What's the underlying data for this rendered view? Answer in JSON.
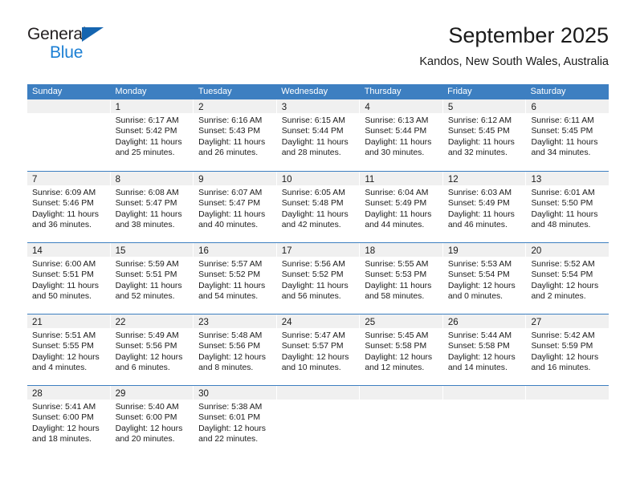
{
  "brand": {
    "line1": "General",
    "line2": "Blue",
    "triangle_color": "#1565b0",
    "blue_text_color": "#1b7fd4"
  },
  "header": {
    "title": "September 2025",
    "subtitle": "Kandos, New South Wales, Australia"
  },
  "theme": {
    "header_blue": "#3d7fc1",
    "day_band_gray": "#f0f0f0",
    "text_color": "#1a1a1a"
  },
  "weekdays": [
    "Sunday",
    "Monday",
    "Tuesday",
    "Wednesday",
    "Thursday",
    "Friday",
    "Saturday"
  ],
  "weeks": [
    [
      {
        "day": "",
        "sunrise": "",
        "sunset": "",
        "daylight1": "",
        "daylight2": ""
      },
      {
        "day": "1",
        "sunrise": "Sunrise: 6:17 AM",
        "sunset": "Sunset: 5:42 PM",
        "daylight1": "Daylight: 11 hours",
        "daylight2": "and 25 minutes."
      },
      {
        "day": "2",
        "sunrise": "Sunrise: 6:16 AM",
        "sunset": "Sunset: 5:43 PM",
        "daylight1": "Daylight: 11 hours",
        "daylight2": "and 26 minutes."
      },
      {
        "day": "3",
        "sunrise": "Sunrise: 6:15 AM",
        "sunset": "Sunset: 5:44 PM",
        "daylight1": "Daylight: 11 hours",
        "daylight2": "and 28 minutes."
      },
      {
        "day": "4",
        "sunrise": "Sunrise: 6:13 AM",
        "sunset": "Sunset: 5:44 PM",
        "daylight1": "Daylight: 11 hours",
        "daylight2": "and 30 minutes."
      },
      {
        "day": "5",
        "sunrise": "Sunrise: 6:12 AM",
        "sunset": "Sunset: 5:45 PM",
        "daylight1": "Daylight: 11 hours",
        "daylight2": "and 32 minutes."
      },
      {
        "day": "6",
        "sunrise": "Sunrise: 6:11 AM",
        "sunset": "Sunset: 5:45 PM",
        "daylight1": "Daylight: 11 hours",
        "daylight2": "and 34 minutes."
      }
    ],
    [
      {
        "day": "7",
        "sunrise": "Sunrise: 6:09 AM",
        "sunset": "Sunset: 5:46 PM",
        "daylight1": "Daylight: 11 hours",
        "daylight2": "and 36 minutes."
      },
      {
        "day": "8",
        "sunrise": "Sunrise: 6:08 AM",
        "sunset": "Sunset: 5:47 PM",
        "daylight1": "Daylight: 11 hours",
        "daylight2": "and 38 minutes."
      },
      {
        "day": "9",
        "sunrise": "Sunrise: 6:07 AM",
        "sunset": "Sunset: 5:47 PM",
        "daylight1": "Daylight: 11 hours",
        "daylight2": "and 40 minutes."
      },
      {
        "day": "10",
        "sunrise": "Sunrise: 6:05 AM",
        "sunset": "Sunset: 5:48 PM",
        "daylight1": "Daylight: 11 hours",
        "daylight2": "and 42 minutes."
      },
      {
        "day": "11",
        "sunrise": "Sunrise: 6:04 AM",
        "sunset": "Sunset: 5:49 PM",
        "daylight1": "Daylight: 11 hours",
        "daylight2": "and 44 minutes."
      },
      {
        "day": "12",
        "sunrise": "Sunrise: 6:03 AM",
        "sunset": "Sunset: 5:49 PM",
        "daylight1": "Daylight: 11 hours",
        "daylight2": "and 46 minutes."
      },
      {
        "day": "13",
        "sunrise": "Sunrise: 6:01 AM",
        "sunset": "Sunset: 5:50 PM",
        "daylight1": "Daylight: 11 hours",
        "daylight2": "and 48 minutes."
      }
    ],
    [
      {
        "day": "14",
        "sunrise": "Sunrise: 6:00 AM",
        "sunset": "Sunset: 5:51 PM",
        "daylight1": "Daylight: 11 hours",
        "daylight2": "and 50 minutes."
      },
      {
        "day": "15",
        "sunrise": "Sunrise: 5:59 AM",
        "sunset": "Sunset: 5:51 PM",
        "daylight1": "Daylight: 11 hours",
        "daylight2": "and 52 minutes."
      },
      {
        "day": "16",
        "sunrise": "Sunrise: 5:57 AM",
        "sunset": "Sunset: 5:52 PM",
        "daylight1": "Daylight: 11 hours",
        "daylight2": "and 54 minutes."
      },
      {
        "day": "17",
        "sunrise": "Sunrise: 5:56 AM",
        "sunset": "Sunset: 5:52 PM",
        "daylight1": "Daylight: 11 hours",
        "daylight2": "and 56 minutes."
      },
      {
        "day": "18",
        "sunrise": "Sunrise: 5:55 AM",
        "sunset": "Sunset: 5:53 PM",
        "daylight1": "Daylight: 11 hours",
        "daylight2": "and 58 minutes."
      },
      {
        "day": "19",
        "sunrise": "Sunrise: 5:53 AM",
        "sunset": "Sunset: 5:54 PM",
        "daylight1": "Daylight: 12 hours",
        "daylight2": "and 0 minutes."
      },
      {
        "day": "20",
        "sunrise": "Sunrise: 5:52 AM",
        "sunset": "Sunset: 5:54 PM",
        "daylight1": "Daylight: 12 hours",
        "daylight2": "and 2 minutes."
      }
    ],
    [
      {
        "day": "21",
        "sunrise": "Sunrise: 5:51 AM",
        "sunset": "Sunset: 5:55 PM",
        "daylight1": "Daylight: 12 hours",
        "daylight2": "and 4 minutes."
      },
      {
        "day": "22",
        "sunrise": "Sunrise: 5:49 AM",
        "sunset": "Sunset: 5:56 PM",
        "daylight1": "Daylight: 12 hours",
        "daylight2": "and 6 minutes."
      },
      {
        "day": "23",
        "sunrise": "Sunrise: 5:48 AM",
        "sunset": "Sunset: 5:56 PM",
        "daylight1": "Daylight: 12 hours",
        "daylight2": "and 8 minutes."
      },
      {
        "day": "24",
        "sunrise": "Sunrise: 5:47 AM",
        "sunset": "Sunset: 5:57 PM",
        "daylight1": "Daylight: 12 hours",
        "daylight2": "and 10 minutes."
      },
      {
        "day": "25",
        "sunrise": "Sunrise: 5:45 AM",
        "sunset": "Sunset: 5:58 PM",
        "daylight1": "Daylight: 12 hours",
        "daylight2": "and 12 minutes."
      },
      {
        "day": "26",
        "sunrise": "Sunrise: 5:44 AM",
        "sunset": "Sunset: 5:58 PM",
        "daylight1": "Daylight: 12 hours",
        "daylight2": "and 14 minutes."
      },
      {
        "day": "27",
        "sunrise": "Sunrise: 5:42 AM",
        "sunset": "Sunset: 5:59 PM",
        "daylight1": "Daylight: 12 hours",
        "daylight2": "and 16 minutes."
      }
    ],
    [
      {
        "day": "28",
        "sunrise": "Sunrise: 5:41 AM",
        "sunset": "Sunset: 6:00 PM",
        "daylight1": "Daylight: 12 hours",
        "daylight2": "and 18 minutes."
      },
      {
        "day": "29",
        "sunrise": "Sunrise: 5:40 AM",
        "sunset": "Sunset: 6:00 PM",
        "daylight1": "Daylight: 12 hours",
        "daylight2": "and 20 minutes."
      },
      {
        "day": "30",
        "sunrise": "Sunrise: 5:38 AM",
        "sunset": "Sunset: 6:01 PM",
        "daylight1": "Daylight: 12 hours",
        "daylight2": "and 22 minutes."
      },
      {
        "day": "",
        "sunrise": "",
        "sunset": "",
        "daylight1": "",
        "daylight2": ""
      },
      {
        "day": "",
        "sunrise": "",
        "sunset": "",
        "daylight1": "",
        "daylight2": ""
      },
      {
        "day": "",
        "sunrise": "",
        "sunset": "",
        "daylight1": "",
        "daylight2": ""
      },
      {
        "day": "",
        "sunrise": "",
        "sunset": "",
        "daylight1": "",
        "daylight2": ""
      }
    ]
  ]
}
